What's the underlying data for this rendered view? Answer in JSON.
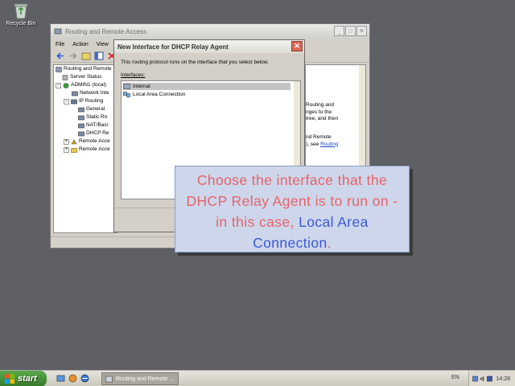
{
  "desktop": {
    "recycle_bin_label": "Recycle Bin"
  },
  "main_window": {
    "title": "Routing and Remote Access",
    "menu": [
      "File",
      "Action",
      "View"
    ],
    "tree": [
      {
        "label": "Routing and Remote",
        "indent": 0
      },
      {
        "label": "Server Status",
        "indent": 1
      },
      {
        "label": "ADMIN1 (local)",
        "indent": 1
      },
      {
        "label": "Network Inte",
        "indent": 2
      },
      {
        "label": "IP Routing",
        "indent": 2
      },
      {
        "label": "General",
        "indent": 3
      },
      {
        "label": "Static Ro",
        "indent": 3
      },
      {
        "label": "NAT/Basi",
        "indent": 3
      },
      {
        "label": "DHCP Re",
        "indent": 3
      },
      {
        "label": "Remote Acce",
        "indent": 2
      },
      {
        "label": "Remote Acce",
        "indent": 2
      }
    ],
    "right_pane": {
      "text_1": "Routing and\nnges to the\ntree, and then",
      "text_2": "nd Remote\n), see ",
      "link": "Routing"
    }
  },
  "dialog": {
    "title": "New Interface for DHCP Relay Agent",
    "close_symbol": "✕",
    "description": "This routing protocol runs on the interface that you select below.",
    "interfaces_label": "Interfaces:",
    "interfaces": [
      {
        "label": "Internal",
        "selected": true
      },
      {
        "label": "Local Area Connection",
        "selected": false
      }
    ]
  },
  "callout": {
    "part_1": "Choose the interface that the DHCP Relay Agent is to run on - in this case, ",
    "highlight": "Local Area Connection",
    "part_2": "."
  },
  "taskbar": {
    "start_label": "start",
    "task_label": "Routing and Remote ...",
    "language": "EN",
    "clock": "14:28"
  },
  "colors": {
    "callout_pink": "#e8626a",
    "callout_blue": "#3c58d8",
    "start_green": "#3f8c33"
  }
}
